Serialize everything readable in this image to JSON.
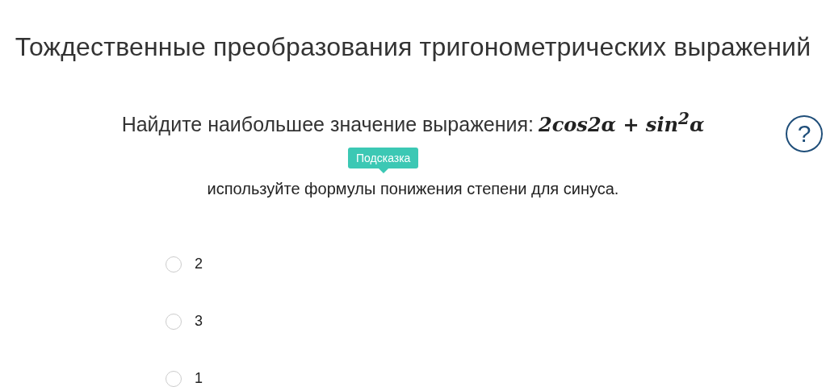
{
  "title": "Тождественные преобразования тригонометрических выражений",
  "question": {
    "text": "Найдите наибольшее значение выражения:",
    "formula": "2cos2α + sin$^{2}$α"
  },
  "hint": {
    "tooltip": "Подсказка",
    "text": "используйте формулы понижения степени для синуса."
  },
  "help": {
    "label": "?"
  },
  "options": [
    {
      "label": "2",
      "selected": false
    },
    {
      "label": "3",
      "selected": false
    },
    {
      "label": "1",
      "selected": false
    }
  ]
}
